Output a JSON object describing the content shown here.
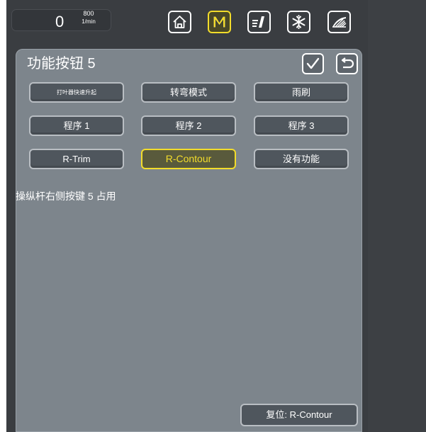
{
  "header": {
    "rpm_value": "0",
    "rpm_max": "800",
    "rpm_unit": "1/min",
    "buttons": [
      {
        "name": "home",
        "icon": "home-icon",
        "active": false
      },
      {
        "name": "manual",
        "icon": "m-mode-icon",
        "label": "M",
        "active": true
      },
      {
        "name": "settings",
        "icon": "seat-adjust-icon",
        "active": false
      },
      {
        "name": "climate",
        "icon": "snowflake-icon",
        "active": false
      },
      {
        "name": "wiper",
        "icon": "wiper-icon",
        "active": false
      }
    ]
  },
  "panel": {
    "title": "功能按钮 5",
    "confirm_icon": "checkmark-icon",
    "back_icon": "return-icon",
    "function_buttons": [
      {
        "label": "打叶器快速升起",
        "active": false
      },
      {
        "label": "转弯模式",
        "active": false
      },
      {
        "label": "雨刷",
        "active": false
      },
      {
        "label": "程序 1",
        "active": false
      },
      {
        "label": "程序 2",
        "active": false
      },
      {
        "label": "程序 3",
        "active": false
      },
      {
        "label": "R-Trim",
        "active": false
      },
      {
        "label": "R-Contour",
        "active": true
      },
      {
        "label": "没有功能",
        "active": false
      }
    ],
    "status_text": "操纵杆右侧按键 5 占用",
    "reset_label": "复位: R-Contour"
  },
  "colors": {
    "accent_yellow": "#f2dc2b",
    "panel_bg": "#7d858c",
    "button_bg": "#4f565d",
    "screen_bg": "#3a3d41"
  }
}
